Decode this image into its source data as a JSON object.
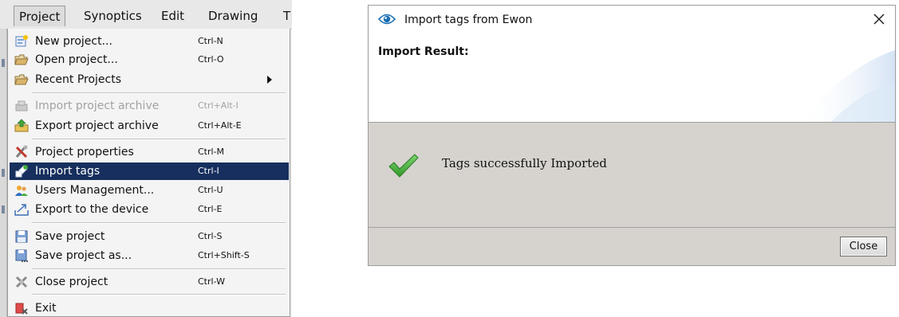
{
  "menubar": {
    "items": [
      "Project",
      "Synoptics",
      "Edit",
      "Drawing",
      "T"
    ]
  },
  "project_menu": {
    "items": [
      {
        "label": "New project...",
        "shortcut": "Ctrl-N",
        "icon": "new-project-icon"
      },
      {
        "label": "Open project...",
        "shortcut": "Ctrl-O",
        "icon": "open-folder-icon"
      },
      {
        "label": "Recent Projects",
        "shortcut": "",
        "icon": "recent-folder-icon",
        "submenu": true
      },
      {
        "label": "Import project archive",
        "shortcut": "Ctrl+Alt-I",
        "icon": "import-archive-icon",
        "disabled": true
      },
      {
        "label": "Export project archive",
        "shortcut": "Ctrl+Alt-E",
        "icon": "export-archive-icon"
      },
      {
        "label": "Project properties",
        "shortcut": "Ctrl-M",
        "icon": "properties-tools-icon"
      },
      {
        "label": "Import tags",
        "shortcut": "Ctrl-I",
        "icon": "import-tags-icon",
        "highlighted": true
      },
      {
        "label": "Users Management...",
        "shortcut": "Ctrl-U",
        "icon": "users-icon"
      },
      {
        "label": "Export to the device",
        "shortcut": "Ctrl-E",
        "icon": "export-device-icon"
      },
      {
        "label": "Save project",
        "shortcut": "Ctrl-S",
        "icon": "save-icon"
      },
      {
        "label": "Save project as...",
        "shortcut": "Ctrl+Shift-S",
        "icon": "save-as-icon"
      },
      {
        "label": "Close project",
        "shortcut": "Ctrl-W",
        "icon": "close-project-icon"
      },
      {
        "label": "Exit",
        "shortcut": "",
        "icon": "exit-icon"
      }
    ]
  },
  "dialog": {
    "title": "Import tags from Ewon",
    "title_icon": "ewon-eye-icon",
    "header": "Import Result:",
    "message": "Tags successfully Imported",
    "message_icon": "success-check-icon",
    "close_button": "Close"
  },
  "colors": {
    "highlight": "#172f5e",
    "menu_background": "#f4f4f4",
    "dialog_content_background": "#d6d3ce",
    "check_green": "#3fae3a"
  }
}
